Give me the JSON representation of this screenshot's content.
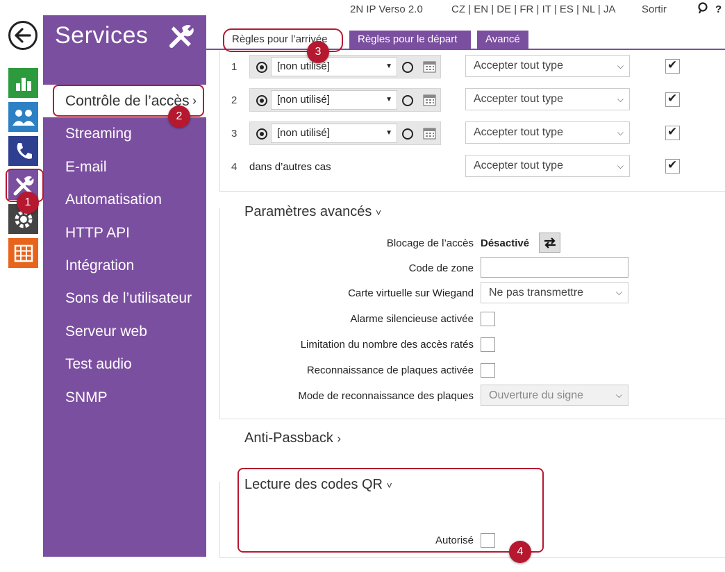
{
  "header": {
    "product": "2N IP Verso 2.0",
    "languages": "CZ | EN | DE | FR | IT | ES | NL | JA",
    "logout": "Sortir",
    "help": "?"
  },
  "menu": {
    "title": "Services",
    "items": [
      {
        "label": "Contrôle de l’accès",
        "chevron": "›"
      },
      {
        "label": "Streaming"
      },
      {
        "label": "E-mail"
      },
      {
        "label": "Automatisation"
      },
      {
        "label": "HTTP API"
      },
      {
        "label": "Intégration"
      },
      {
        "label": "Sons de l’utilisateur"
      },
      {
        "label": "Serveur web"
      },
      {
        "label": "Test audio"
      },
      {
        "label": "SNMP"
      }
    ]
  },
  "tabs": {
    "arrival": "Règles pour l’arrivée",
    "departure": "Règles pour le départ",
    "advanced": "Avancé"
  },
  "rules": {
    "rows": [
      {
        "num": "1",
        "profile": "[non utilisé]",
        "type": "Accepter tout type",
        "checked": true
      },
      {
        "num": "2",
        "profile": "[non utilisé]",
        "type": "Accepter tout type",
        "checked": true
      },
      {
        "num": "3",
        "profile": "[non utilisé]",
        "type": "Accepter tout type",
        "checked": true
      }
    ],
    "other": {
      "num": "4",
      "label": "dans d’autres cas",
      "type": "Accepter tout type",
      "checked": true
    }
  },
  "advanced": {
    "title": "Paramètres avancés",
    "chevron": "˅",
    "lock_label": "Blocage de l’accès",
    "lock_value": "Désactivé",
    "zone_label": "Code de zone",
    "zone_value": "",
    "wiegand_label": "Carte virtuelle sur Wiegand",
    "wiegand_value": "Ne pas transmettre",
    "silent_alarm_label": "Alarme silencieuse activée",
    "failed_limit_label": "Limitation du nombre des accès ratés",
    "plate_recognition_label": "Reconnaissance de plaques activée",
    "plate_mode_label": "Mode de reconnaissance des plaques",
    "plate_mode_value": "Ouverture du signe"
  },
  "anti_passback": {
    "title": "Anti-Passback",
    "chevron": "›"
  },
  "qr": {
    "title": "Lecture des codes QR",
    "chevron": "˅",
    "allowed_label": "Autorisé"
  },
  "callouts": [
    "1",
    "2",
    "3",
    "4"
  ],
  "colors": {
    "accent": "#7b4fa0",
    "callout": "#b5182f",
    "green": "#2e9a3e",
    "blue": "#2d80c4",
    "navy": "#2f3f8f",
    "orange": "#e8641c"
  }
}
